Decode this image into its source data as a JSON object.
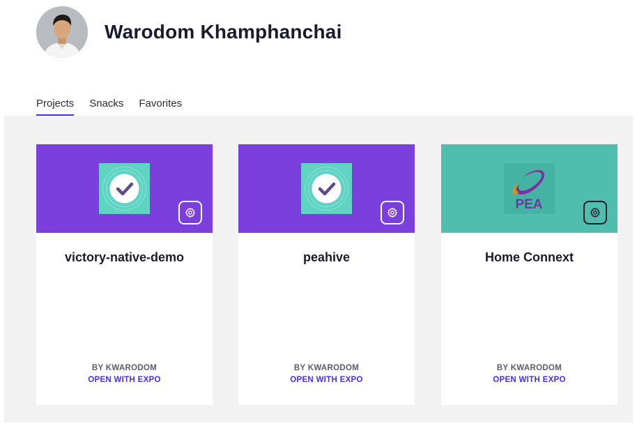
{
  "user": {
    "name": "Warodom Khamphanchai"
  },
  "tabs": [
    {
      "label": "Projects",
      "active": true
    },
    {
      "label": "Snacks",
      "active": false
    },
    {
      "label": "Favorites",
      "active": false
    }
  ],
  "colors": {
    "accent": "#4630eb",
    "banner_purple": "#7a3fdc",
    "banner_teal": "#4fbeaf",
    "panel_bg": "#f2f2f2"
  },
  "projects": [
    {
      "title": "victory-native-demo",
      "by": "BY KWARODOM",
      "open_label": "OPEN WITH EXPO",
      "icon": "check-icon",
      "banner": "purple"
    },
    {
      "title": "peahive",
      "by": "BY KWARODOM",
      "open_label": "OPEN WITH EXPO",
      "icon": "check-icon",
      "banner": "purple"
    },
    {
      "title": "Home Connext",
      "by": "BY KWARODOM",
      "open_label": "OPEN WITH EXPO",
      "icon": "pea-logo",
      "banner": "teal",
      "logo_text": "PEA"
    }
  ]
}
